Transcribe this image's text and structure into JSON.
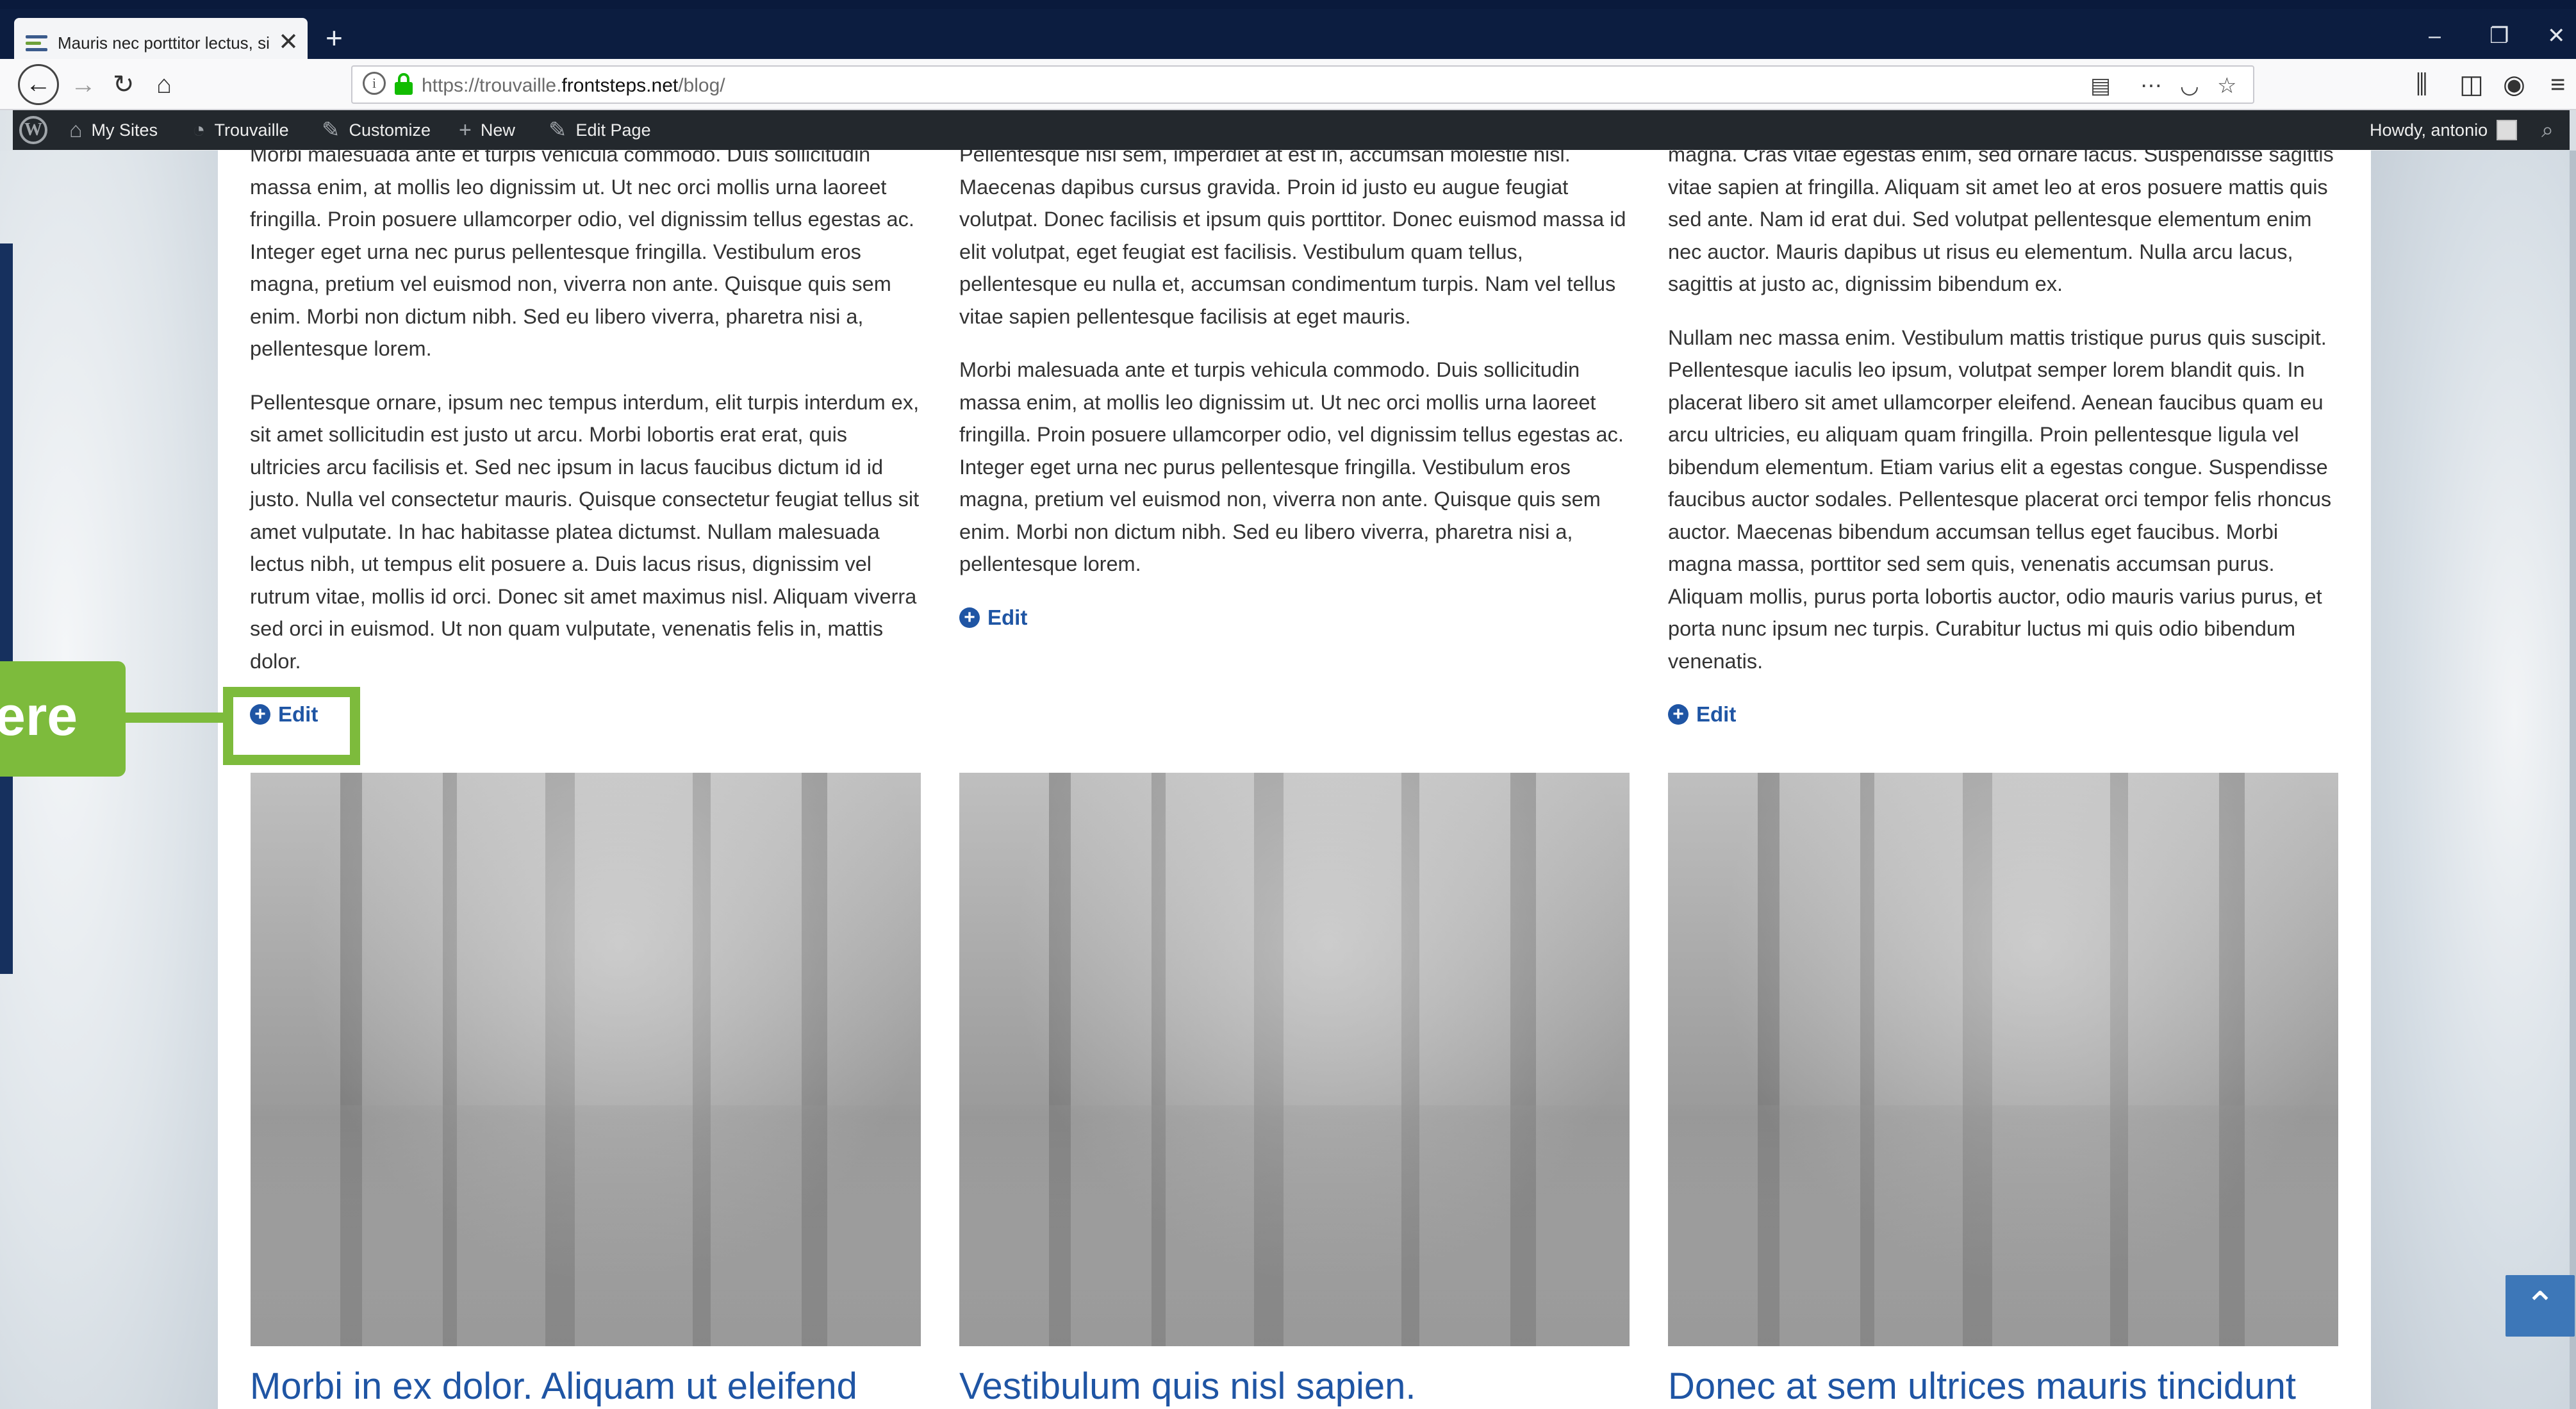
{
  "browser": {
    "tab_title": "Mauris nec porttitor lectus, sit a",
    "tab_close": "✕",
    "new_tab": "+",
    "window_controls": {
      "minimize": "–",
      "restore": "❐",
      "close": "✕"
    },
    "url_scheme_host": "https://trouvaille.",
    "url_domain": "frontsteps.net",
    "url_path": "/blog/"
  },
  "admin_bar": {
    "my_sites": "My Sites",
    "site_name": "Trouvaille",
    "customize": "Customize",
    "new": "New",
    "edit_page": "Edit Page",
    "howdy": "Howdy, antonio"
  },
  "posts": [
    {
      "paragraphs": [
        "Morbi malesuada ante et turpis vehicula commodo. Duis sollicitudin massa enim, at mollis leo dignissim ut. Ut nec orci mollis urna laoreet fringilla. Proin posuere ullamcorper odio, vel dignissim tellus egestas ac. Integer eget urna nec purus pellentesque fringilla. Vestibulum eros magna, pretium vel euismod non, viverra non ante. Quisque quis sem enim. Morbi non dictum nibh. Sed eu libero viverra, pharetra nisi a, pellentesque lorem.",
        "Pellentesque ornare, ipsum nec tempus interdum, elit turpis interdum ex, sit amet sollicitudin est justo ut arcu. Morbi lobortis erat erat, quis ultricies arcu facilisis et. Sed nec ipsum in lacus faucibus dictum id id justo. Nulla vel consectetur mauris. Quisque consectetur feugiat tellus sit amet vulputate. In hac habitasse platea dictumst. Nullam malesuada lectus nibh, ut tempus elit posuere a. Duis lacus risus, dignissim vel rutrum vitae, mollis id orci. Donec sit amet maximus nisl. Aliquam viverra sed orci in euismod. Ut non quam vulputate, venenatis felis in, mattis dolor."
      ],
      "edit_label": "Edit",
      "next_title": "Morbi in ex dolor. Aliquam ut eleifend"
    },
    {
      "paragraphs": [
        "Pellentesque nisi sem, imperdiet at est in, accumsan molestie nisl. Maecenas dapibus cursus gravida. Proin id justo eu augue feugiat volutpat. Donec facilisis et ipsum quis porttitor. Donec euismod massa id elit volutpat, eget feugiat est facilisis. Vestibulum quam tellus, pellentesque eu nulla et, accumsan condimentum turpis. Nam vel tellus vitae sapien pellentesque facilisis at eget mauris.",
        "Morbi malesuada ante et turpis vehicula commodo. Duis sollicitudin massa enim, at mollis leo dignissim ut. Ut nec orci mollis urna laoreet fringilla. Proin posuere ullamcorper odio, vel dignissim tellus egestas ac. Integer eget urna nec purus pellentesque fringilla. Vestibulum eros magna, pretium vel euismod non, viverra non ante. Quisque quis sem enim. Morbi non dictum nibh. Sed eu libero viverra, pharetra nisi a, pellentesque lorem."
      ],
      "edit_label": "Edit",
      "next_title": "Vestibulum quis nisl sapien."
    },
    {
      "paragraphs": [
        "magna. Cras vitae egestas enim, sed ornare lacus. Suspendisse sagittis vitae sapien at fringilla. Aliquam sit amet leo at eros posuere mattis quis sed ante. Nam id erat dui. Sed volutpat pellentesque elementum enim nec auctor. Mauris dapibus ut risus eu elementum. Nulla arcu lacus, sagittis at justo ac, dignissim bibendum ex.",
        "Nullam nec massa enim. Vestibulum mattis tristique purus quis suscipit. Pellentesque iaculis leo ipsum, volutpat semper lorem blandit quis. In placerat libero sit amet ullamcorper eleifend. Aenean faucibus quam eu arcu ultricies, eu aliquam quam fringilla. Proin pellentesque ligula vel bibendum elementum. Etiam varius elit a egestas congue. Suspendisse faucibus auctor sodales. Pellentesque placerat orci tempor felis rhoncus auctor. Maecenas bibendum accumsan tellus eget faucibus. Morbi magna massa, porttitor sed sem quis, venenatis accumsan purus. Aliquam mollis, purus porta lobortis auctor, odio mauris varius purus, et porta nunc ipsum nec turpis. Curabitur luctus mi quis odio bibendum venenatis."
      ],
      "edit_label": "Edit",
      "next_title": "Donec at sem ultrices mauris tincidunt"
    }
  ],
  "callout": {
    "text": "ere"
  },
  "colors": {
    "accent": "#1f55a4",
    "callout": "#7dbb3c",
    "admin_bar": "#23282d"
  },
  "icons": {
    "back": "back-arrow-icon",
    "forward": "forward-arrow-icon",
    "reload": "reload-icon",
    "home": "home-icon",
    "scroll_top": "chevron-up-icon"
  }
}
